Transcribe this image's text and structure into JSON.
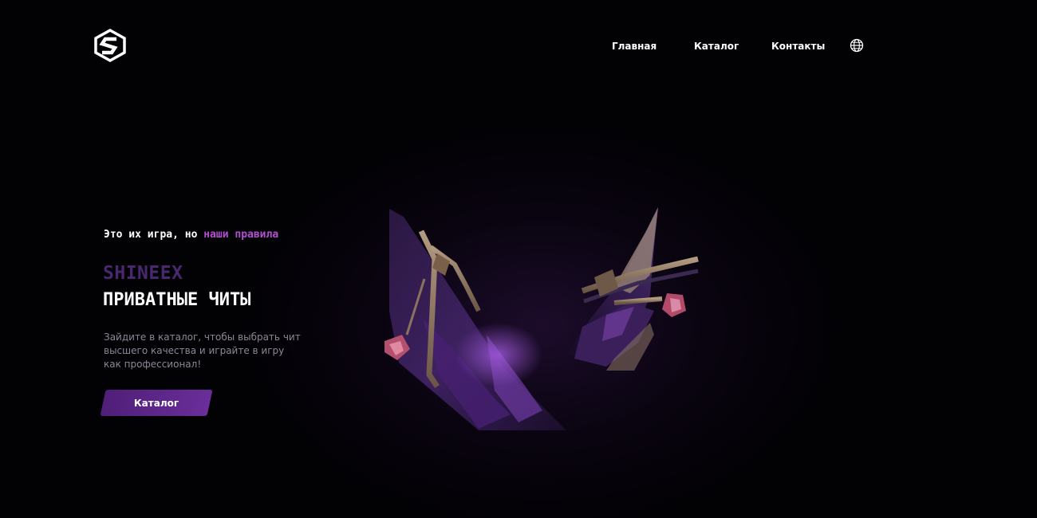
{
  "header": {
    "logo_icon": "hexagon-s-logo-icon",
    "nav": {
      "home": "Главная",
      "catalog": "Каталог",
      "contacts": "Контакты"
    },
    "language_icon": "globe-icon"
  },
  "hero": {
    "tagline_start": "Это их игра, но ",
    "tagline_accent": "наши правила",
    "brand": "SHINEEX",
    "headline": "ПРИВАТНЫЕ ЧИТЫ",
    "description": "Зайдите в каталог, чтобы выбрать чит высшего качества и играйте в игру как профессионал!",
    "cta_label": "Каталог",
    "art_icon": "crystal-v-emblem-icon"
  },
  "colors": {
    "background": "#020104",
    "accent": "#b34fd1",
    "brand": "#4a2870",
    "button": "#5a2688",
    "muted_text": "#8e8796"
  }
}
